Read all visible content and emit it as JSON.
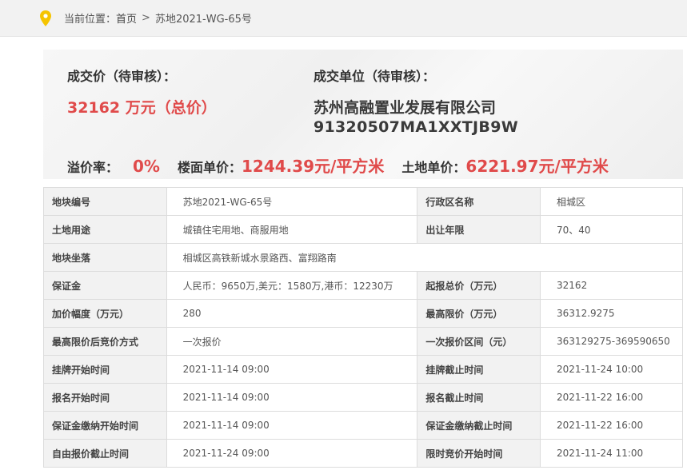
{
  "breadcrumb": {
    "prefix": "当前位置：",
    "home": "首页",
    "separator": ">",
    "current": "苏地2021-WG-65号"
  },
  "summary": {
    "price_label": "成交价（待审核）：",
    "price_value": "32162 万元（总价）",
    "winner_label": "成交单位（待审核）：",
    "winner_name": "苏州高融置业发展有限公司",
    "winner_code": "91320507MA1XXTJB9W",
    "premium_label": "溢价率：",
    "premium_value": "0%",
    "floor_price_label": "楼面单价：",
    "floor_price_value": "1244.39元/平方米",
    "land_price_label": "土地单价：",
    "land_price_value": "6221.97元/平方米"
  },
  "table": {
    "rows": [
      {
        "k1": "地块编号",
        "v1": "苏地2021-WG-65号",
        "k2": "行政区名称",
        "v2": "相城区"
      },
      {
        "k1": "土地用途",
        "v1": "城镇住宅用地、商服用地",
        "k2": "出让年限",
        "v2": "70、40"
      },
      {
        "k1": "地块坐落",
        "v1": "相城区高铁新城水景路西、富翔路南"
      },
      {
        "k1": "保证金",
        "v1": "人民币：9650万,美元：1580万,港币：12230万",
        "k2": "起报总价（万元）",
        "v2": "32162"
      },
      {
        "k1": "加价幅度（万元）",
        "v1": "280",
        "k2": "最高限价（万元）",
        "v2": "36312.9275"
      },
      {
        "k1": "最高限价后竞价方式",
        "v1": "一次报价",
        "k2": "一次报价区间（元）",
        "v2": "363129275-369590650"
      },
      {
        "k1": "挂牌开始时间",
        "v1": "2021-11-14 09:00",
        "k2": "挂牌截止时间",
        "v2": "2021-11-24 10:00"
      },
      {
        "k1": "报名开始时间",
        "v1": "2021-11-14 09:00",
        "k2": "报名截止时间",
        "v2": "2021-11-22 16:00"
      },
      {
        "k1": "保证金缴纳开始时间",
        "v1": "2021-11-14 09:00",
        "k2": "保证金缴纳截止时间",
        "v2": "2021-11-22 16:00"
      },
      {
        "k1": "自由报价截止时间",
        "v1": "2021-11-24 09:00",
        "k2": "限时竞价开始时间",
        "v2": "2021-11-24 11:00"
      }
    ]
  },
  "colors": {
    "accent_red": "#e04a4a",
    "pin_icon": "#f5c400",
    "header_bg": "#f2f2f2"
  }
}
